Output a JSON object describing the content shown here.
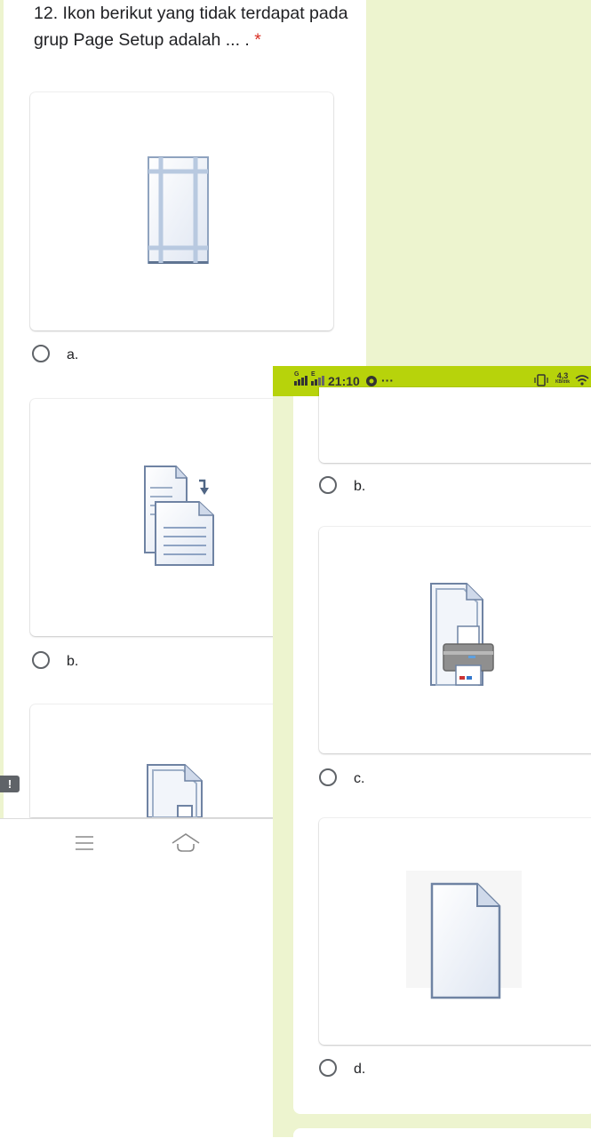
{
  "question": {
    "text": "12. Ikon berikut yang tidak terdapat pada grup Page Setup adalah ... .",
    "required_mark": "*"
  },
  "left_options": [
    {
      "label": "a.",
      "icon": "margins-icon"
    },
    {
      "label": "b.",
      "icon": "breaks-icon"
    },
    {
      "label": "",
      "icon": "print-preview-icon"
    }
  ],
  "right_options": [
    {
      "label": "b."
    },
    {
      "label": "c.",
      "icon": "print-icon"
    },
    {
      "label": "d.",
      "icon": "blank-page-icon"
    }
  ],
  "status_bar": {
    "time": "21:10",
    "more": "···",
    "net_speed": "4,3",
    "net_unit": "KB/dtk",
    "sim1": "G",
    "sim2": "E"
  },
  "warning_badge": "!",
  "colors": {
    "page_bg": "#edf4cf",
    "status_bar": "#b7d30b",
    "required": "#d93025",
    "radio": "#5f6368"
  }
}
